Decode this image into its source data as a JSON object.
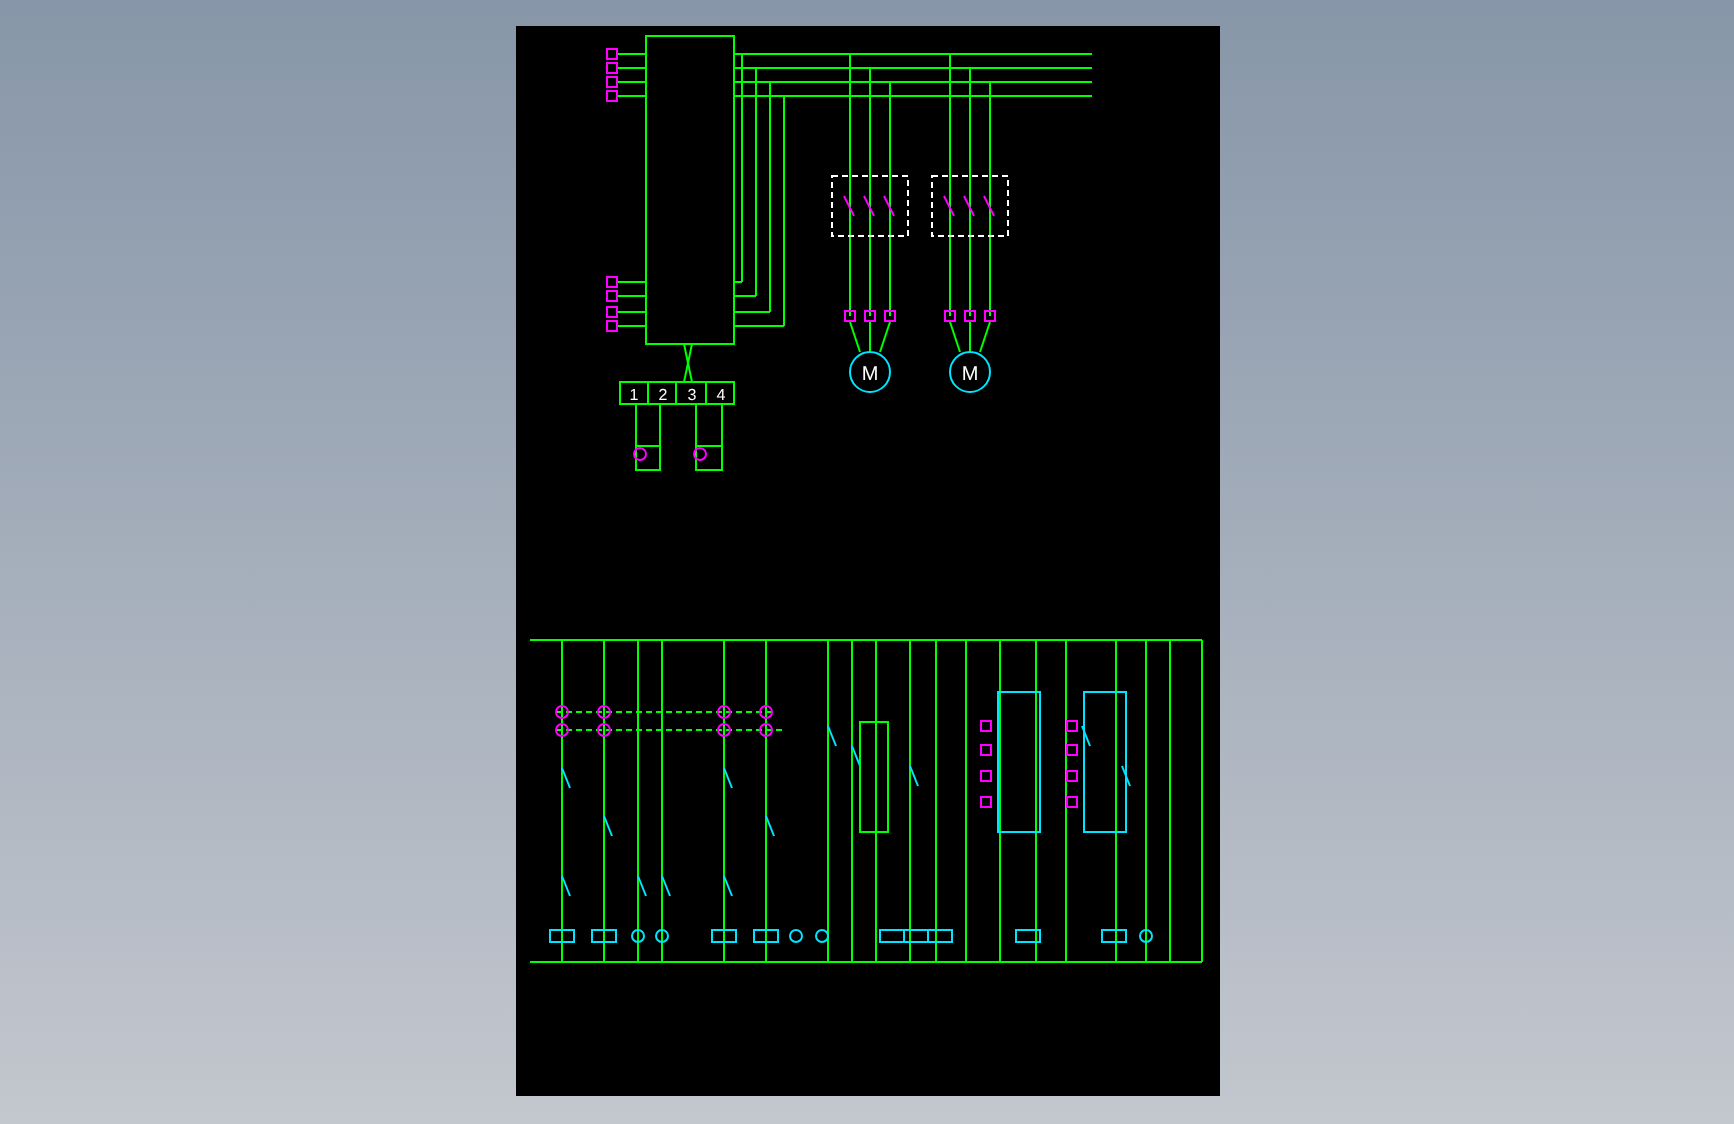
{
  "sheet": {
    "terminal_block": [
      "1",
      "2",
      "3",
      "4"
    ],
    "motors": [
      {
        "label": "M"
      },
      {
        "label": "M"
      }
    ]
  }
}
